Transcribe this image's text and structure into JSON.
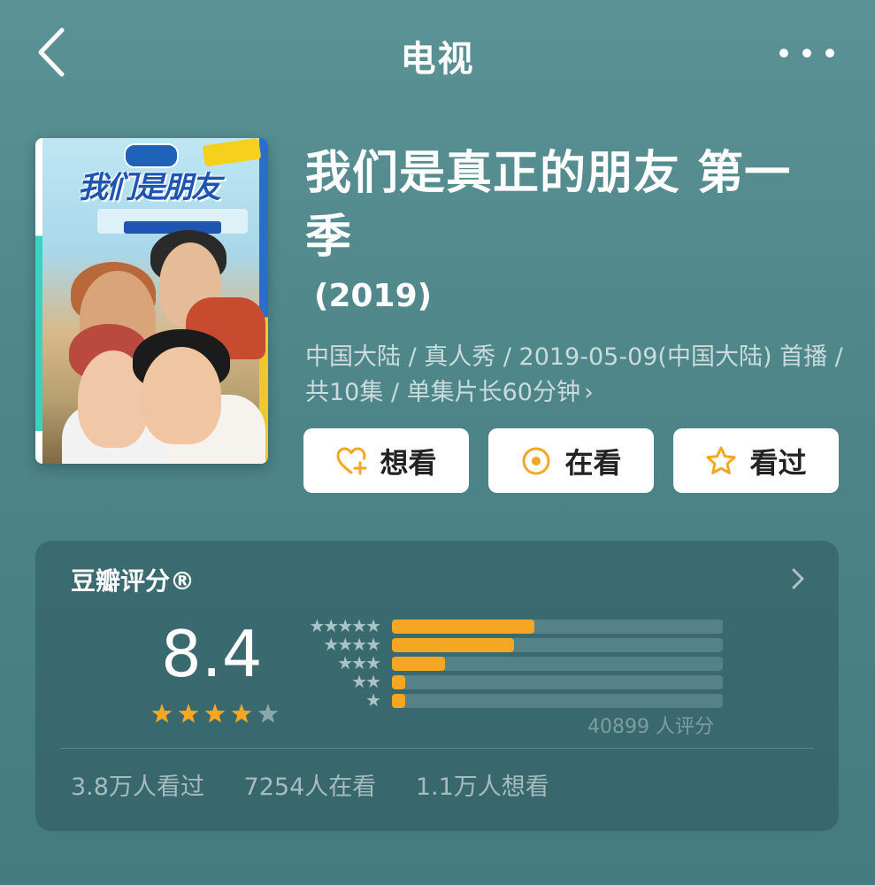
{
  "header": {
    "title": "电视",
    "back_icon": "chevron-left-icon",
    "more_icon": "more-dots-icon"
  },
  "show": {
    "title": "我们是真正的朋友 第一季",
    "year": "(2019)",
    "meta": "中国大陆 / 真人秀 / 2019-05-09(中国大陆) 首播 / 共10集 / 单集片长60分钟",
    "meta_chevron": "›",
    "poster_title": "我们是朋友"
  },
  "actions": {
    "want_label": "想看",
    "watching_label": "在看",
    "watched_label": "看过",
    "accent_color": "#f5a623"
  },
  "rating": {
    "heading": "豆瓣评分®",
    "score": "8.4",
    "stars_filled": 4,
    "stars_total": 5,
    "rating_count": "40899 人评分",
    "distribution": [
      {
        "stars": "★★★★★",
        "fraction": 0.43
      },
      {
        "stars": "★★★★",
        "fraction": 0.37
      },
      {
        "stars": "★★★",
        "fraction": 0.16
      },
      {
        "stars": "★★",
        "fraction": 0.04
      },
      {
        "stars": "★",
        "fraction": 0.04
      }
    ]
  },
  "stats": {
    "watched": "3.8万人看过",
    "watching": "7254人在看",
    "want": "1.1万人想看"
  }
}
